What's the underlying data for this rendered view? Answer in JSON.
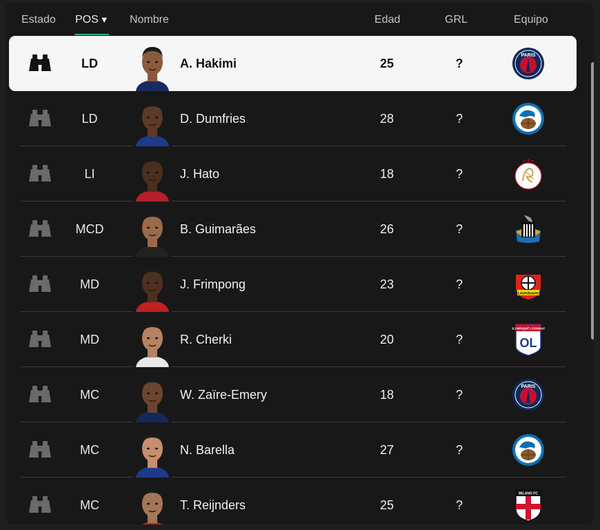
{
  "header": {
    "estado": "Estado",
    "pos": "POS",
    "sort_indicator": "▼",
    "nombre": "Nombre",
    "edad": "Edad",
    "grl": "GRL",
    "equipo": "Equipo"
  },
  "colors": {
    "accent": "#2fb38a",
    "selected_row_bg": "#f6f6f6",
    "row_divider": "#3a3a3a",
    "binoculars_inactive": "#6a6a6a",
    "binoculars_active": "#111111"
  },
  "players": [
    {
      "pos": "LD",
      "name": "A. Hakimi",
      "age": "25",
      "grl": "?",
      "team_icon": "psg-crest-icon",
      "selected": true
    },
    {
      "pos": "LD",
      "name": "D. Dumfries",
      "age": "28",
      "grl": "?",
      "team_icon": "inter-crest-icon",
      "selected": false
    },
    {
      "pos": "LI",
      "name": "J. Hato",
      "age": "18",
      "grl": "?",
      "team_icon": "ajax-crest-icon",
      "selected": false
    },
    {
      "pos": "MCD",
      "name": "B. Guimarães",
      "age": "26",
      "grl": "?",
      "team_icon": "newcastle-crest-icon",
      "selected": false
    },
    {
      "pos": "MD",
      "name": "J. Frimpong",
      "age": "23",
      "grl": "?",
      "team_icon": "leverkusen-crest-icon",
      "selected": false
    },
    {
      "pos": "MD",
      "name": "R. Cherki",
      "age": "20",
      "grl": "?",
      "team_icon": "lyon-crest-icon",
      "selected": false
    },
    {
      "pos": "MC",
      "name": "W. Zaïre-Emery",
      "age": "18",
      "grl": "?",
      "team_icon": "psg-crest-icon",
      "selected": false
    },
    {
      "pos": "MC",
      "name": "N. Barella",
      "age": "27",
      "grl": "?",
      "team_icon": "inter-crest-icon",
      "selected": false
    },
    {
      "pos": "MC",
      "name": "T. Reijnders",
      "age": "25",
      "grl": "?",
      "team_icon": "milan-crest-icon",
      "selected": false
    }
  ],
  "crest_text": {
    "psg": "PARIS",
    "lyon_top": "OLYMPIQUE LYONNAIS",
    "lyon_mark": "OL",
    "milan": "MILANO FC",
    "leverkusen": "Leverkusen"
  }
}
